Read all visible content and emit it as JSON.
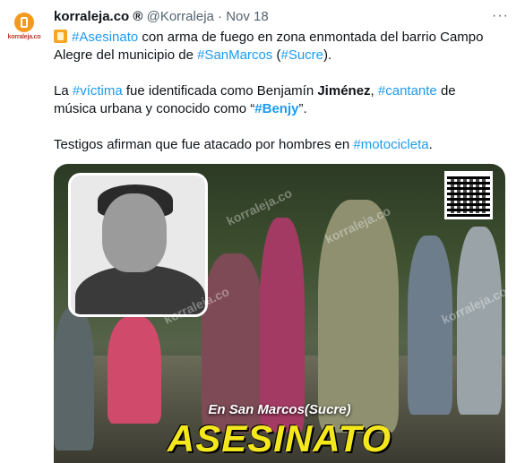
{
  "account": {
    "avatar_text": "korraleja.co",
    "display_name": "korraleja.co ®",
    "handle": "@Korraleja",
    "separator": "·",
    "date": "Nov 18",
    "more_label": "···"
  },
  "tweet": {
    "p1": {
      "hashtag1": "#Asesinato",
      "text1": " con arma de fuego en zona enmontada del barrio Campo Alegre del municipio de ",
      "hashtag2": "#SanMarcos",
      "text2": " (",
      "hashtag3": "#Sucre",
      "text3": ")."
    },
    "p2": {
      "text1": "La ",
      "hashtag1": "#víctima",
      "text2": " fue identificada como Benjamín ",
      "bold1": "Jiménez",
      "text3": ", ",
      "hashtag2": "#cantante",
      "text4": " de música urbana y conocido como “",
      "hashtag3": "#Benjy",
      "text5": "”."
    },
    "p3": {
      "text1": "Testigos afirman que fue atacado por hombres en ",
      "hashtag1": "#motocicleta",
      "text2": "."
    }
  },
  "media": {
    "watermark": "korraleja.co",
    "subheadline": "En San Marcos(Sucre)",
    "headline": "ASESINATO"
  }
}
